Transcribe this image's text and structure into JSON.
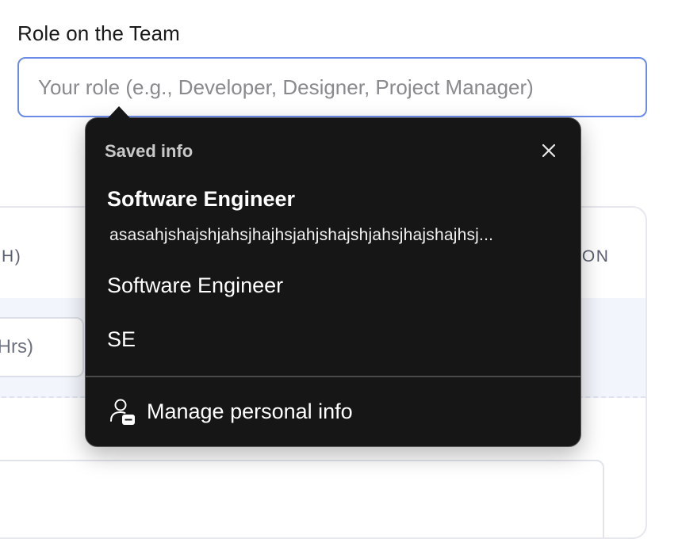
{
  "form": {
    "label": "Role on the Team",
    "input_placeholder": "Your role (e.g., Developer, Designer, Project Manager)",
    "input_value": ""
  },
  "background_table": {
    "header_left": "H)",
    "header_right": "TION",
    "hours_input_text": "Hrs)"
  },
  "autofill_popup": {
    "title": "Saved info",
    "close_icon": "close-icon",
    "suggestions": [
      {
        "primary": "Software Engineer",
        "secondary": "asasahjshajshjahsjhajhsjahjshajshjahsjhajshajhsj..."
      },
      {
        "primary": "Software Engineer"
      },
      {
        "primary": "SE"
      }
    ],
    "manage_label": "Manage personal info",
    "manage_icon": "person-card-icon"
  },
  "colors": {
    "input_focus_border": "#6b8be8",
    "popup_background": "#161616",
    "row_highlight": "#f3f5fd"
  }
}
